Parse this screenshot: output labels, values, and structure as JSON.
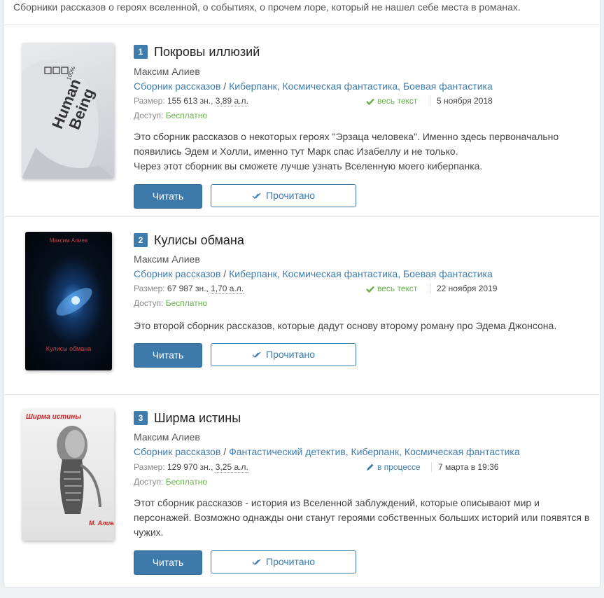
{
  "intro": "Сборники рассказов о героях вселенной, о событиях, о прочем лоре, который не нашел себе места в романах.",
  "labels": {
    "size": "Размер:",
    "access": "Доступ:",
    "read_button": "Читать",
    "mark_read_button": "Прочитано"
  },
  "colors": {
    "accent": "#3f7cae",
    "free": "#6ab04c"
  },
  "books": [
    {
      "number": "1",
      "title": "Покровы иллюзий",
      "author": "Максим Алиев",
      "genres": [
        "Сборник рассказов",
        "Киберпанк",
        "Космическая фантастика",
        "Боевая фантастика"
      ],
      "size_chars": "155 613 зн.,",
      "size_al": "3,89 а.л.",
      "status": "весь текст",
      "status_icon": "check-icon",
      "date": "5 ноября 2018",
      "access": "Бесплатно",
      "description": [
        "Это сборник рассказов о некоторых героях \"Эрзаца человека\". Именно здесь первоначально появились Эдем и Холли, именно тут Марк спас Изабеллу и не только.",
        "Через этот сборник вы сможете лучше узнать Вселенную моего киберпанка."
      ],
      "cover_text": [
        "Human",
        "Being",
        "100%"
      ]
    },
    {
      "number": "2",
      "title": "Кулисы обмана",
      "author": "Максим Алиев",
      "genres": [
        "Сборник рассказов",
        "Киберпанк",
        "Космическая фантастика",
        "Боевая фантастика"
      ],
      "size_chars": "67 987 зн.,",
      "size_al": "1,70 а.л.",
      "status": "весь текст",
      "status_icon": "check-icon",
      "date": "22 ноября 2019",
      "access": "Бесплатно",
      "description": [
        "Это второй сборник рассказов, которые дадут основу второму роману про Эдема Джонсона."
      ],
      "cover_text": [
        "Максим Алиев",
        "Кулисы обмана"
      ]
    },
    {
      "number": "3",
      "title": "Ширма истины",
      "author": "Максим Алиев",
      "genres": [
        "Сборник рассказов",
        "Фантастический детектив",
        "Киберпанк",
        "Космическая фантастика"
      ],
      "size_chars": "129 970 зн.,",
      "size_al": "3,25 а.л.",
      "status": "в процессе",
      "status_icon": "pencil-icon",
      "date": "7 марта в 19:36",
      "access": "Бесплатно",
      "description": [
        "Этот сборник рассказов - история из Вселенной заблуждений, которые описывают мир и персонажей. Возможно однажды они станут героями собственных больших историй или появятся в чужих."
      ],
      "cover_text": [
        "Ширма истины",
        "М. Алиев"
      ]
    }
  ]
}
